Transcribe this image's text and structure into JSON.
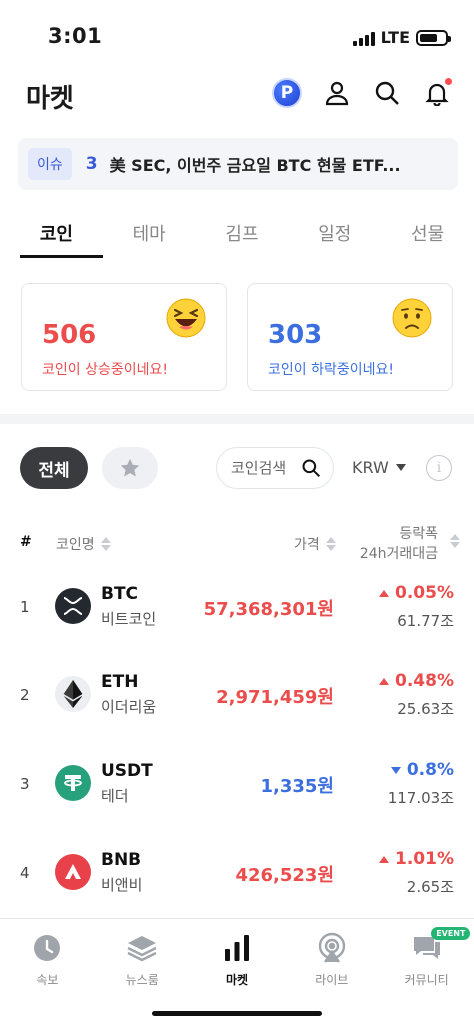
{
  "status_bar": {
    "time": "3:01",
    "network": "LTE"
  },
  "header": {
    "title": "마켓",
    "points_badge": "P"
  },
  "issue": {
    "tag": "이슈",
    "rank": "3",
    "text": "美 SEC, 이번주 금요일 BTC 현물 ETF..."
  },
  "tabs": [
    {
      "label": "코인",
      "active": true
    },
    {
      "label": "테마"
    },
    {
      "label": "김프"
    },
    {
      "label": "일정"
    },
    {
      "label": "선물"
    }
  ],
  "summary": {
    "up": {
      "count": "506",
      "label": "코인이 상승중이네요!",
      "color": "#ec4c4c"
    },
    "down": {
      "count": "303",
      "label": "코인이 하락중이네요!",
      "color": "#3b6fe0"
    }
  },
  "filters": {
    "all_label": "전체",
    "search_placeholder": "코인검색",
    "currency": "KRW"
  },
  "table": {
    "headers": {
      "rank": "#",
      "name": "코인명",
      "price": "가격",
      "change": "등락폭",
      "volume": "24h거래대금"
    },
    "rows": [
      {
        "rank": "1",
        "symbol": "BTC",
        "name": "비트코인",
        "price": "57,368,301원",
        "change": "0.05%",
        "direction": "up",
        "volume": "61.77조",
        "icon": "xrp-style-logo-icon"
      },
      {
        "rank": "2",
        "symbol": "ETH",
        "name": "이더리움",
        "price": "2,971,459원",
        "change": "0.48%",
        "direction": "up",
        "volume": "25.63조",
        "icon": "ethereum-logo-icon"
      },
      {
        "rank": "3",
        "symbol": "USDT",
        "name": "테더",
        "price": "1,335원",
        "change": "0.8%",
        "direction": "down",
        "volume": "117.03조",
        "icon": "tether-logo-icon"
      },
      {
        "rank": "4",
        "symbol": "BNB",
        "name": "비앤비",
        "price": "426,523원",
        "change": "1.01%",
        "direction": "up",
        "volume": "2.65조",
        "icon": "bnb-logo-icon"
      }
    ]
  },
  "bottom_nav": [
    {
      "label": "속보",
      "icon": "clock-icon"
    },
    {
      "label": "뉴스룸",
      "icon": "layers-icon"
    },
    {
      "label": "마켓",
      "icon": "bar-chart-icon",
      "active": true
    },
    {
      "label": "라이브",
      "icon": "broadcast-icon"
    },
    {
      "label": "커뮤니티",
      "icon": "chat-icon",
      "badge": "EVENT"
    }
  ]
}
